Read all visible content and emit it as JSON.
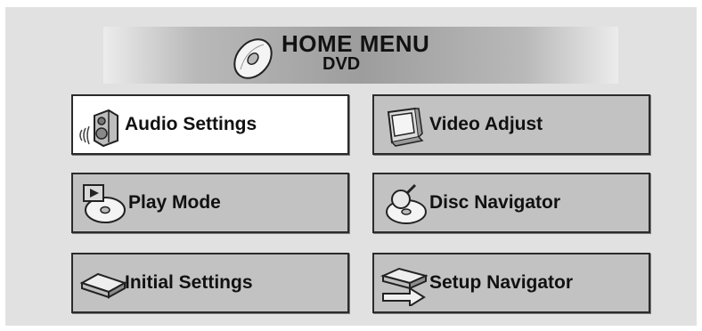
{
  "header": {
    "title": "HOME MENU",
    "subtitle": "DVD",
    "icon": "disc-icon"
  },
  "menu": {
    "items": [
      {
        "label": "Audio Settings",
        "icon": "speaker-icon",
        "selected": true
      },
      {
        "label": "Video Adjust",
        "icon": "tv-icon",
        "selected": false
      },
      {
        "label": "Play Mode",
        "icon": "play-disc-icon",
        "selected": false
      },
      {
        "label": "Disc Navigator",
        "icon": "magnify-disc-icon",
        "selected": false
      },
      {
        "label": "Initial Settings",
        "icon": "player-icon",
        "selected": false
      },
      {
        "label": "Setup Navigator",
        "icon": "player-arrow-icon",
        "selected": false
      }
    ]
  },
  "colors": {
    "background": "#e1e1e1",
    "button_face": "#c2c2c2",
    "button_selected": "#ffffff",
    "border": "#2b2b2b"
  }
}
